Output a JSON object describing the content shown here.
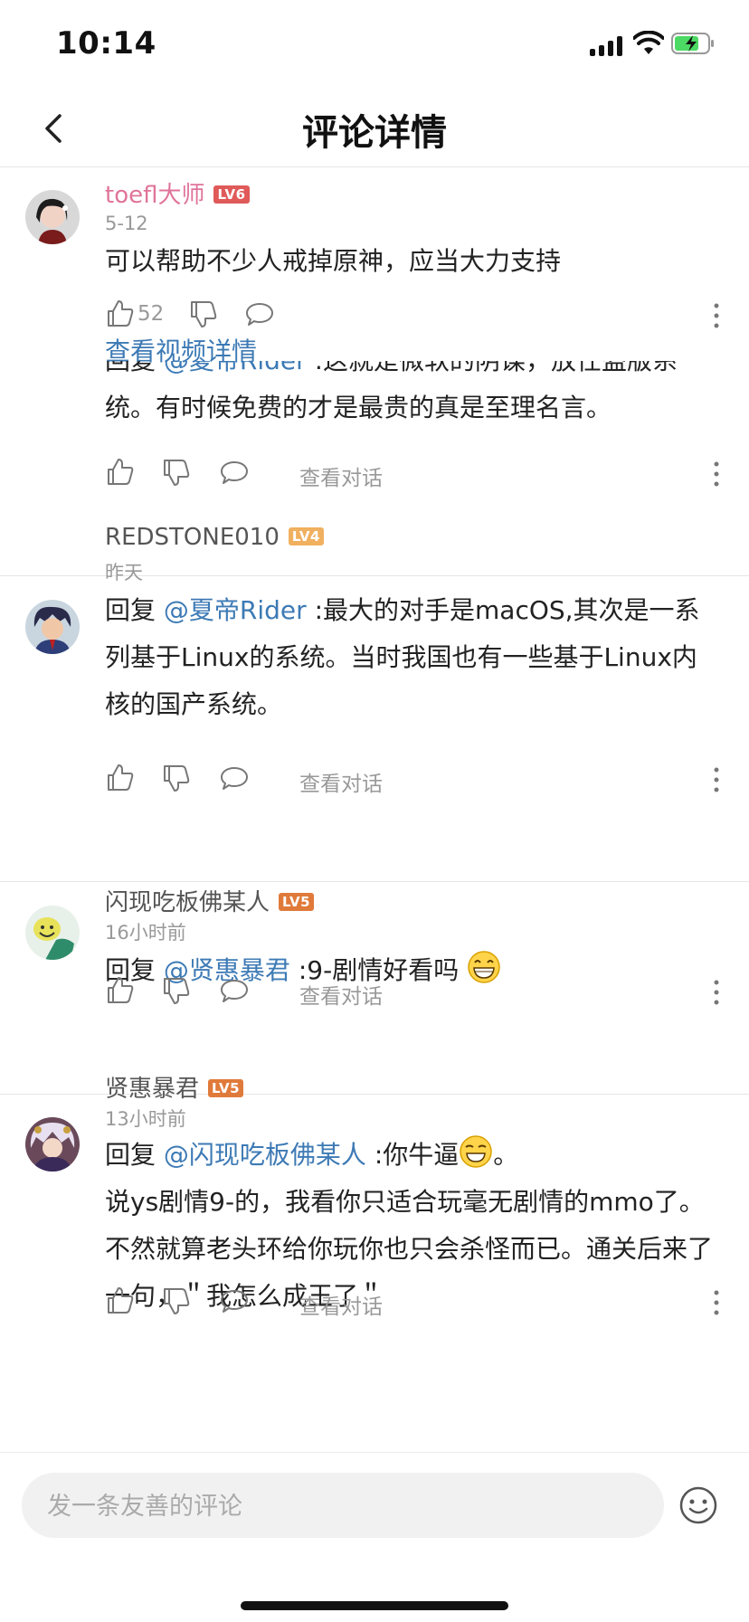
{
  "status": {
    "time": "10:14"
  },
  "nav": {
    "title": "评论详情"
  },
  "main_comment": {
    "username": "toefl大师",
    "level": "LV6",
    "date": "5-12",
    "text": "可以帮助不少人戒掉原神，应当大力支持",
    "likes": "52",
    "view_video": "查看视频详情"
  },
  "replies": [
    {
      "reply_prefix": "回复",
      "mention": "@夏帝Rider",
      "text_line1_tail": " :这就是微软的阴谋，放任盗版系",
      "text_rest": "统。有时候免费的才是最贵的真是至理名言。",
      "view_conversation": "查看对话"
    },
    {
      "username": "REDSTONE010",
      "level": "LV4",
      "date": "昨天",
      "reply_prefix": "回复",
      "mention": "@夏帝Rider",
      "text": " :最大的对手是macOS,其次是一系列基于Linux的系统。当时我国也有一些基于Linux内核的国产系统。",
      "view_conversation": "查看对话"
    },
    {
      "username": "闪现吃板佛某人",
      "level": "LV5",
      "date": "16小时前",
      "reply_prefix": "回复",
      "mention": "@贤惠暴君",
      "text": " :9-剧情好看吗",
      "view_conversation": "查看对话"
    },
    {
      "username": "贤惠暴君",
      "level": "LV5",
      "date": "13小时前",
      "reply_prefix": "回复",
      "mention": "@闪现吃板佛某人",
      "text_a": " :你牛逼",
      "text_b": "。",
      "text_c": "说ys剧情9-的，我看你只适合玩毫无剧情的mmo了。不然就算老头环给你玩你也只会杀怪而已。通关后来了一句，＂我怎么成王了＂",
      "view_conversation": "查看对话"
    }
  ],
  "input": {
    "placeholder": "发一条友善的评论"
  },
  "colors": {
    "accent": "#3d7ab5",
    "vip_name": "#e0749a",
    "lv6": "#e05a5a",
    "lv5": "#e07a3a",
    "lv4": "#f0b060"
  },
  "icons": [
    "back-icon",
    "thumbs-up-icon",
    "thumbs-down-icon",
    "comment-icon",
    "more-icon",
    "emoji-icon"
  ]
}
